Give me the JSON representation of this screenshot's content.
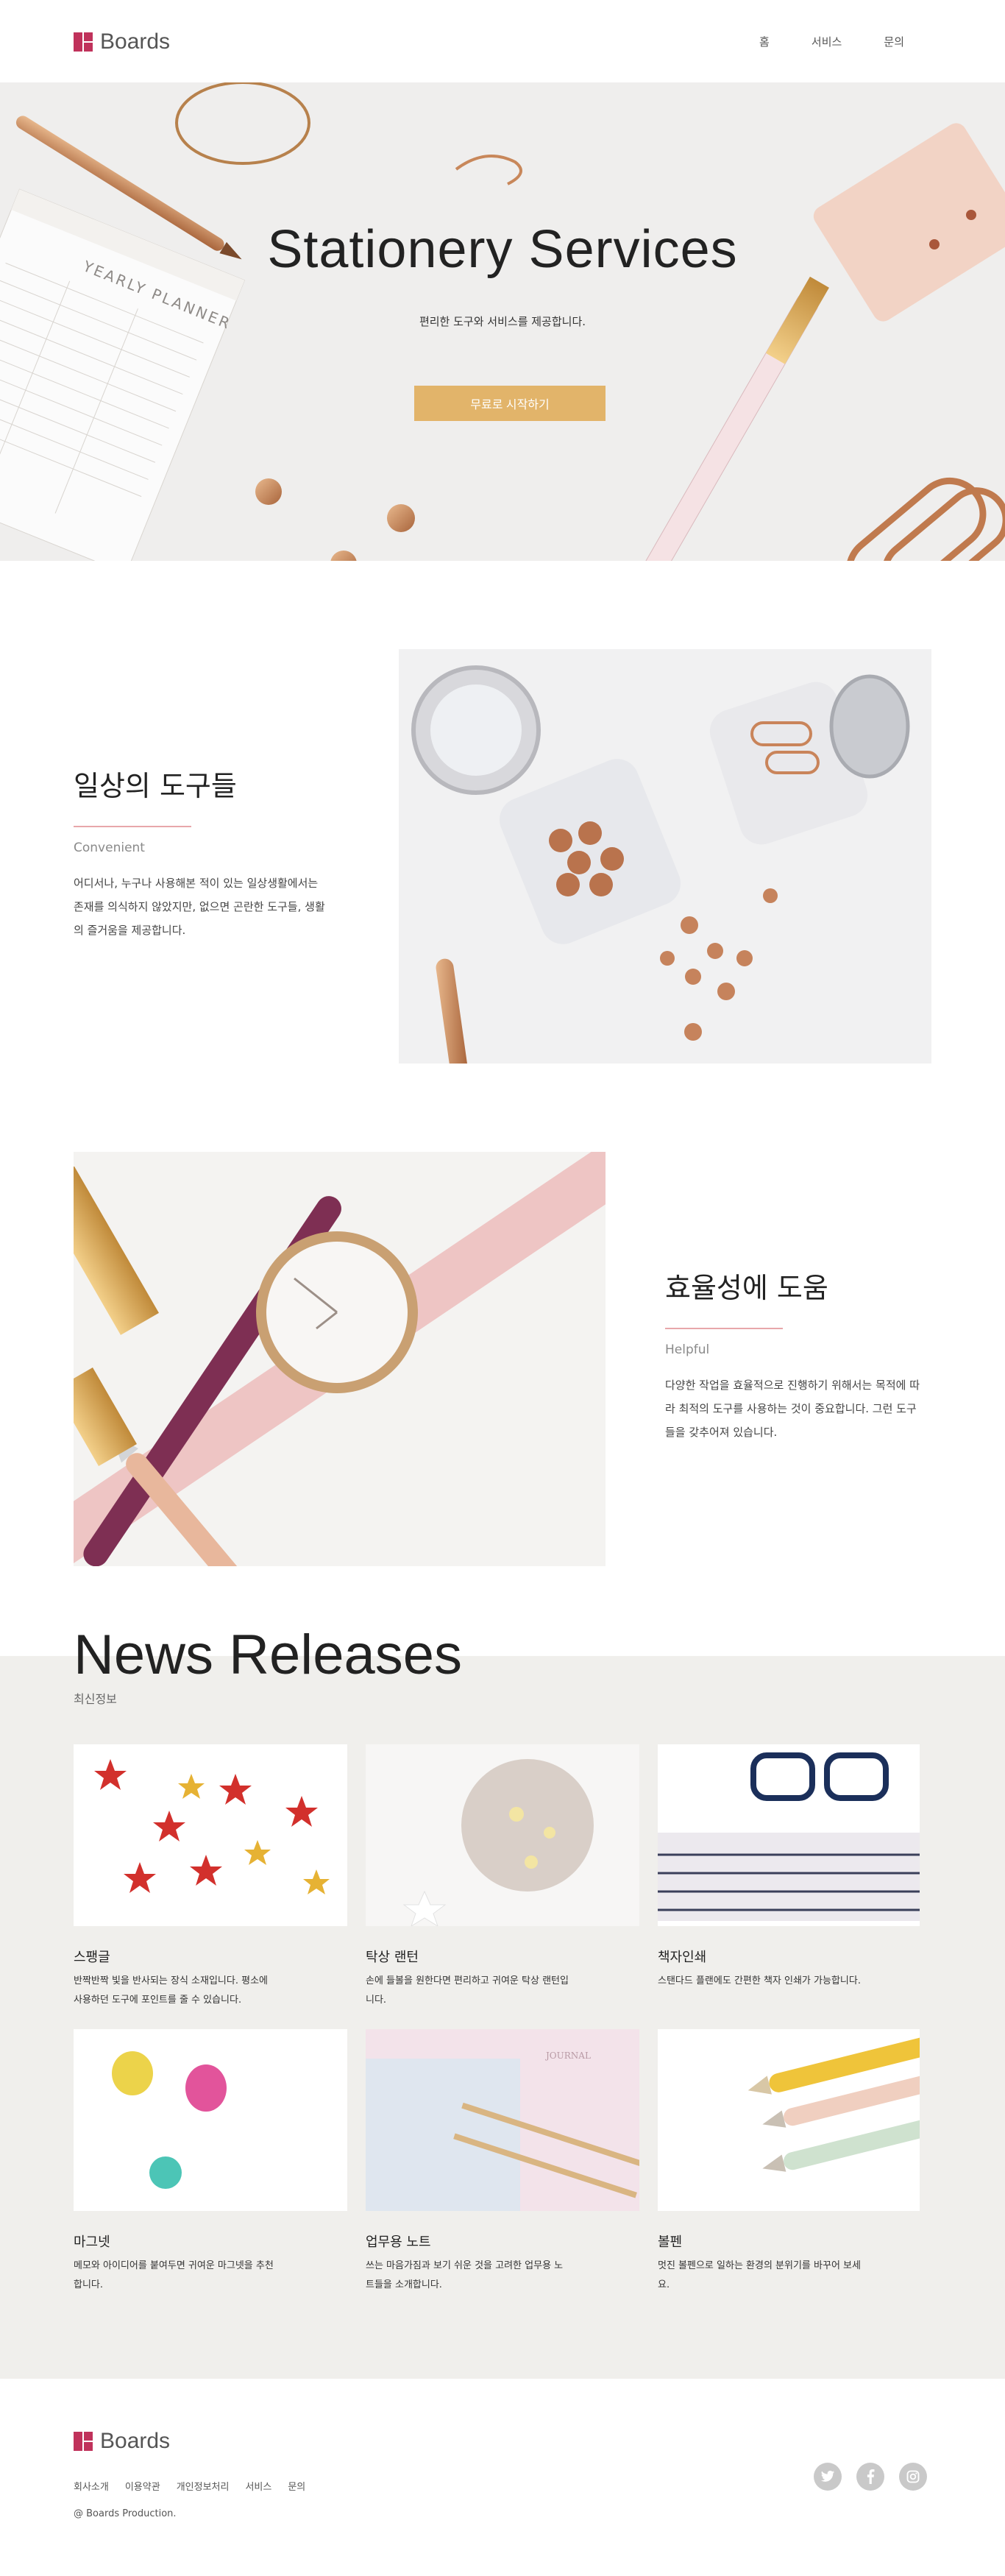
{
  "header": {
    "brand": "Boards",
    "nav": [
      "홈",
      "서비스",
      "문의"
    ]
  },
  "hero": {
    "title": "Stationery Services",
    "subtitle": "편리한 도구와 서비스를 제공합니다.",
    "cta": "무료로 시작하기",
    "planner_text": "YEARLY PLANNER"
  },
  "features": [
    {
      "title": "일상의 도구들",
      "subtitle": "Convenient",
      "desc_lines": [
        "어디서나, 누구나 사용해본 적이 있는 일상생활에서는",
        "존재를 의식하지 않았지만, 없으면 곤란한 도구들, 생활",
        "의 즐거움을 제공합니다."
      ]
    },
    {
      "title": "효율성에 도움",
      "subtitle": "Helpful",
      "desc_lines": [
        "다양한 작업을 효율적으로 진행하기 위해서는 목적에 따",
        "라 최적의 도구를 사용하는 것이 중요합니다. 그런 도구",
        "들을 갖추어져 있습니다."
      ]
    }
  ],
  "news": {
    "title": "News Releases",
    "subtitle": "최신정보",
    "items": [
      {
        "title": "스팽글",
        "desc_lines": [
          "반짝반짝 빛을 반사되는 장식 소재입니다. 평소에",
          "사용하던 도구에 포인트를 줄 수 있습니다."
        ]
      },
      {
        "title": "탁상 랜턴",
        "desc_lines": [
          "손에 들볼을 원한다면 편리하고 귀여운 탁상 랜턴입",
          "니다."
        ]
      },
      {
        "title": "책자인쇄",
        "desc_lines": [
          "스탠다드 플랜에도 간편한 책자 인쇄가 가능합니다."
        ]
      },
      {
        "title": "마그넷",
        "desc_lines": [
          "메모와 아이디어를 붙여두면 귀여운 마그넷을 추천",
          "합니다."
        ]
      },
      {
        "title": "업무용 노트",
        "desc_lines": [
          "쓰는 마음가짐과 보기 쉬운 것을 고려한 업무용 노",
          "트들을 소개합니다."
        ]
      },
      {
        "title": "볼펜",
        "desc_lines": [
          "멋진 볼펜으로 일하는 환경의 분위기를 바꾸어 보세",
          "요."
        ]
      }
    ]
  },
  "footer": {
    "brand": "Boards",
    "links": [
      "회사소개",
      "이용약관",
      "개인정보처리",
      "서비스",
      "문의"
    ],
    "copyright": "@ Boards Production.",
    "social": [
      "twitter-icon",
      "facebook-icon",
      "instagram-icon"
    ]
  },
  "colors": {
    "accent": "#c0325b",
    "button": "#e2b46a",
    "rule": "#e8a7aa",
    "news_bg": "#f0efec"
  }
}
